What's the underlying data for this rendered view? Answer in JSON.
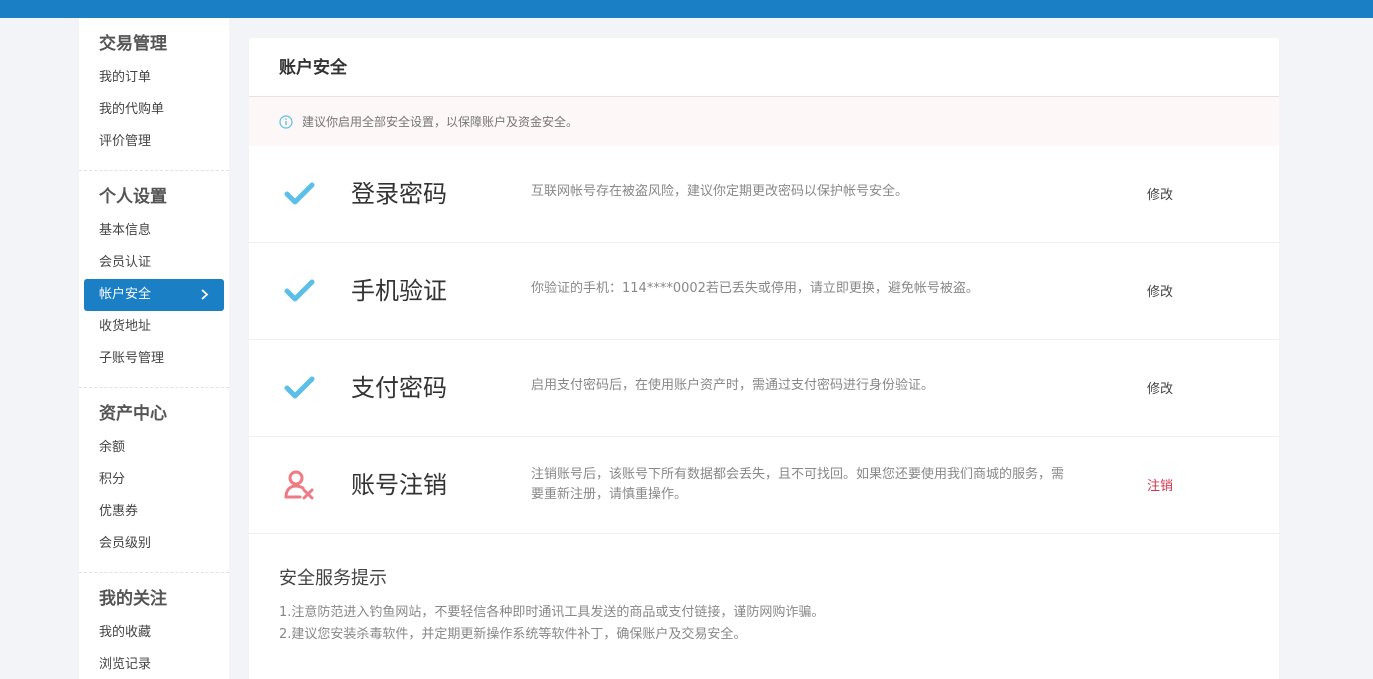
{
  "sidebar": {
    "groups": [
      {
        "title": "交易管理",
        "items": [
          "我的订单",
          "我的代购单",
          "评价管理"
        ]
      },
      {
        "title": "个人设置",
        "items": [
          "基本信息",
          "会员认证",
          "帐户安全",
          "收货地址",
          "子账号管理"
        ]
      },
      {
        "title": "资产中心",
        "items": [
          "余额",
          "积分",
          "优惠券",
          "会员级别"
        ]
      },
      {
        "title": "我的关注",
        "items": [
          "我的收藏",
          "浏览记录"
        ]
      }
    ],
    "active_item": "帐户安全"
  },
  "main": {
    "title": "账户安全",
    "notice": "建议你启用全部安全设置，以保障账户及资金安全。",
    "rows": [
      {
        "icon": "check-icon",
        "label": "登录密码",
        "desc": "互联网帐号存在被盗风险，建议你定期更改密码以保护帐号安全。",
        "action": "修改"
      },
      {
        "icon": "check-icon",
        "label": "手机验证",
        "desc": "你验证的手机：114****0002若已丢失或停用，请立即更换，避免帐号被盗。",
        "action": "修改"
      },
      {
        "icon": "check-icon",
        "label": "支付密码",
        "desc": "启用支付密码后，在使用账户资产时，需通过支付密码进行身份验证。",
        "action": "修改"
      },
      {
        "icon": "user-remove-icon",
        "label": "账号注销",
        "desc": "注销账号后，该账号下所有数据都会丢失，且不可找回。如果您还要使用我们商城的服务，需要重新注册，请慎重操作。",
        "action": "注销"
      }
    ],
    "tips": {
      "title": "安全服务提示",
      "lines": [
        "1.注意防范进入钓鱼网站，不要轻信各种即时通讯工具发送的商品或支付链接，谨防网购诈骗。",
        "2.建议您安装杀毒软件，并定期更新操作系统等软件补丁，确保账户及交易安全。"
      ]
    }
  },
  "colors": {
    "accent": "#1a7fc4",
    "check": "#5bbfe8",
    "danger": "#d0354f",
    "danger_icon": "#ef7a83"
  }
}
